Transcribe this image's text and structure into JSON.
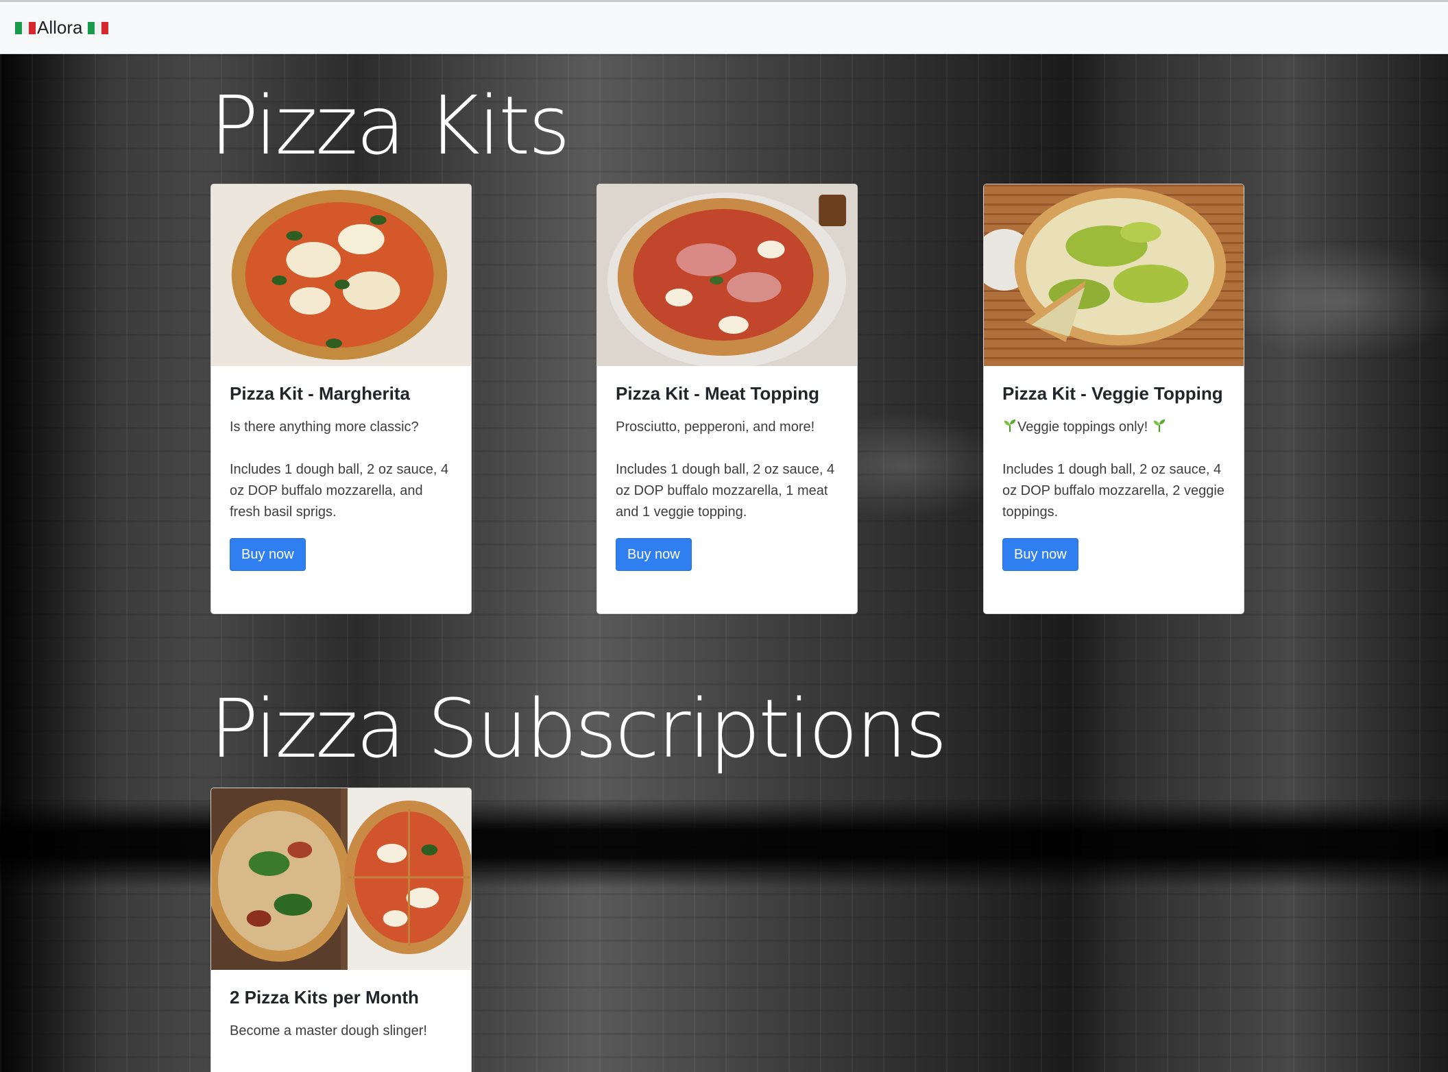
{
  "nav": {
    "brand": "Allora"
  },
  "sections": {
    "kits_title": "Pizza Kits",
    "subscriptions_title": "Pizza Subscriptions"
  },
  "kits": [
    {
      "title": "Pizza Kit - Margherita",
      "tagline": "Is there anything more classic?",
      "description": "Includes 1 dough ball, 2 oz sauce, 4 oz DOP buffalo mozzarella, and fresh basil sprigs.",
      "button": "Buy now"
    },
    {
      "title": "Pizza Kit - Meat Topping",
      "tagline": "Prosciutto, pepperoni, and more!",
      "description": "Includes 1 dough ball, 2 oz sauce, 4 oz DOP buffalo mozzarella, 1 meat and 1 veggie topping.",
      "button": "Buy now"
    },
    {
      "title": "Pizza Kit - Veggie Topping",
      "tagline": "Veggie toppings only!",
      "description": "Includes 1 dough ball, 2 oz sauce, 4 oz DOP buffalo mozzarella, 2 veggie toppings.",
      "button": "Buy now"
    }
  ],
  "subscriptions": [
    {
      "title": "2 Pizza Kits per Month",
      "tagline": "Become a master dough slinger!"
    }
  ]
}
